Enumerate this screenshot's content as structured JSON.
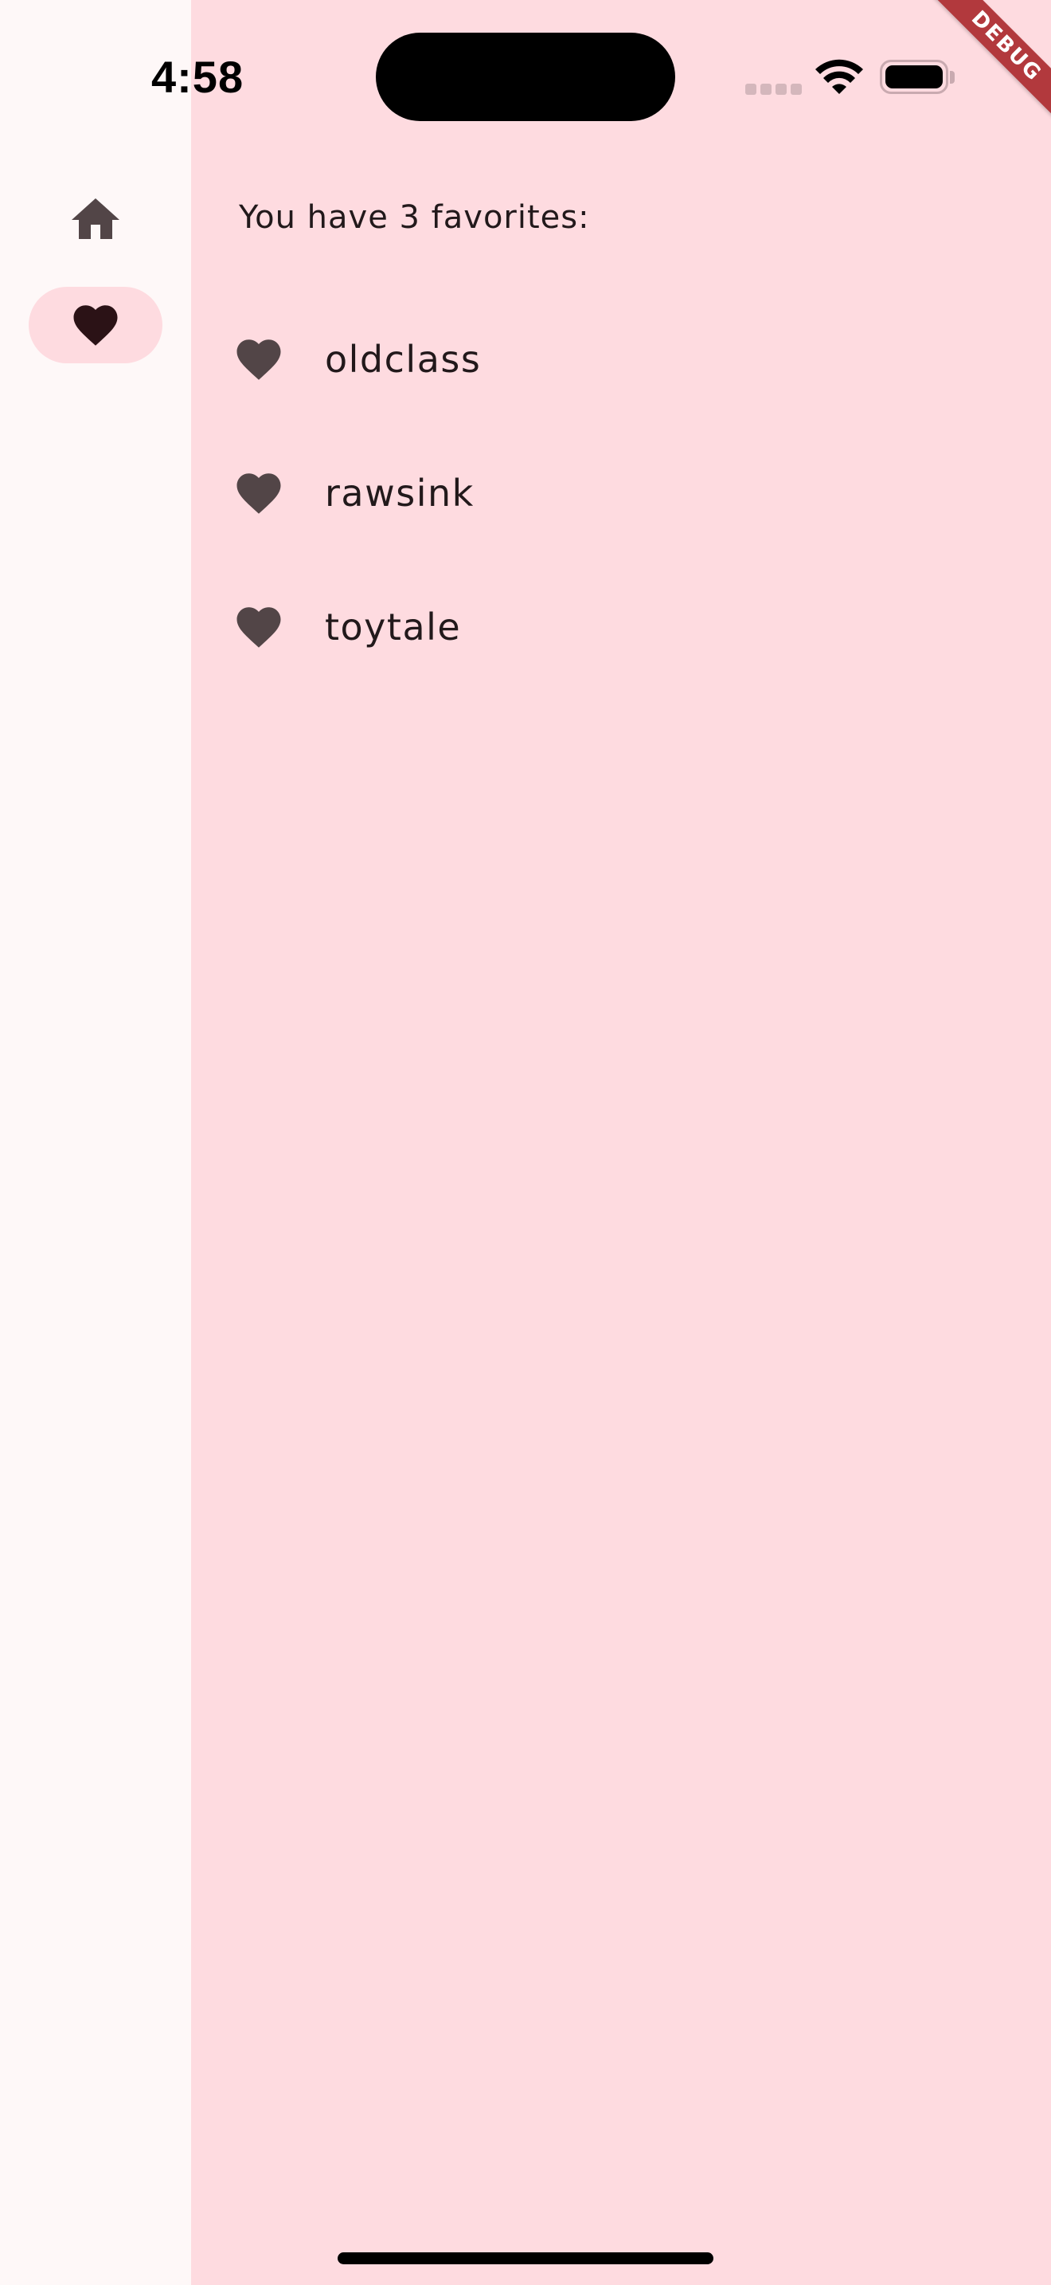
{
  "status_bar": {
    "time": "4:58"
  },
  "debug_banner": "DEBUG",
  "navigation_rail": {
    "items": [
      {
        "icon": "home-icon",
        "selected": false
      },
      {
        "icon": "heart-icon",
        "selected": true
      }
    ]
  },
  "favorites": {
    "header": "You have 3 favorites:",
    "items": [
      {
        "icon": "heart-icon",
        "label": "oldclass"
      },
      {
        "icon": "heart-icon",
        "label": "rawsink"
      },
      {
        "icon": "heart-icon",
        "label": "toytale"
      }
    ]
  },
  "colors": {
    "content_background": "#fedbe0",
    "rail_background": "#fef8f8",
    "selected_indicator": "#fedbe0",
    "icon": "#524547",
    "selected_icon": "#2b1216",
    "text": "#22191b",
    "debug_banner": "#b2393d"
  }
}
